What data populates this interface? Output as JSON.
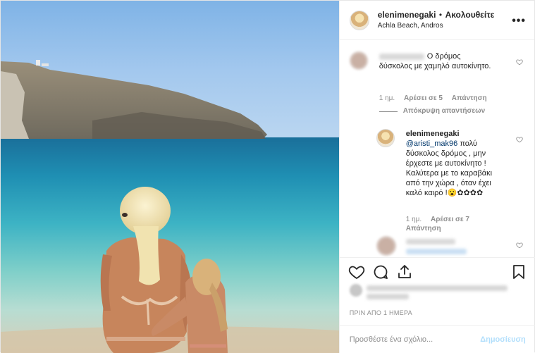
{
  "header": {
    "username": "elenimenegaki",
    "separator": "•",
    "follow_label": "Ακολουθείτε",
    "location": "Achla Beach, Andros",
    "more_icon": "more-horizontal-icon"
  },
  "comments": [
    {
      "text": "Ο δρόμος δύσκολος με χαμηλό αυτοκίνητο.",
      "age": "1 ημ.",
      "likes": "Αρέσει σε 5",
      "reply": "Απάντηση",
      "hide_replies": "Απόκρυψη απαντήσεων"
    },
    {
      "username": "elenimenegaki",
      "mention": "@aristi_mak96",
      "text": "πολύ δύσκολος δρόμος , μην έρχεστε με αυτοκίνητο ! Καλύτερα με το καραβάκι από την χώρα , όταν έχει καλό καιρό !😮✿✿✿✿",
      "age": "1 ημ.",
      "likes": "Αρέσει σε 7",
      "reply": "Απάντηση"
    }
  ],
  "actions": {
    "like_icon": "heart-icon",
    "comment_icon": "comment-icon",
    "share_icon": "share-icon",
    "save_icon": "bookmark-icon"
  },
  "timestamp": "ΠΡΙΝ ΑΠΟ 1 ΗΜΕΡΑ",
  "add_comment": {
    "placeholder": "Προσθέστε ένα σχόλιο...",
    "post_label": "Δημοσίευση"
  },
  "colors": {
    "text": "#262626",
    "muted": "#8e8e8e",
    "link": "#00376b",
    "post_disabled": "#b2dffc"
  }
}
